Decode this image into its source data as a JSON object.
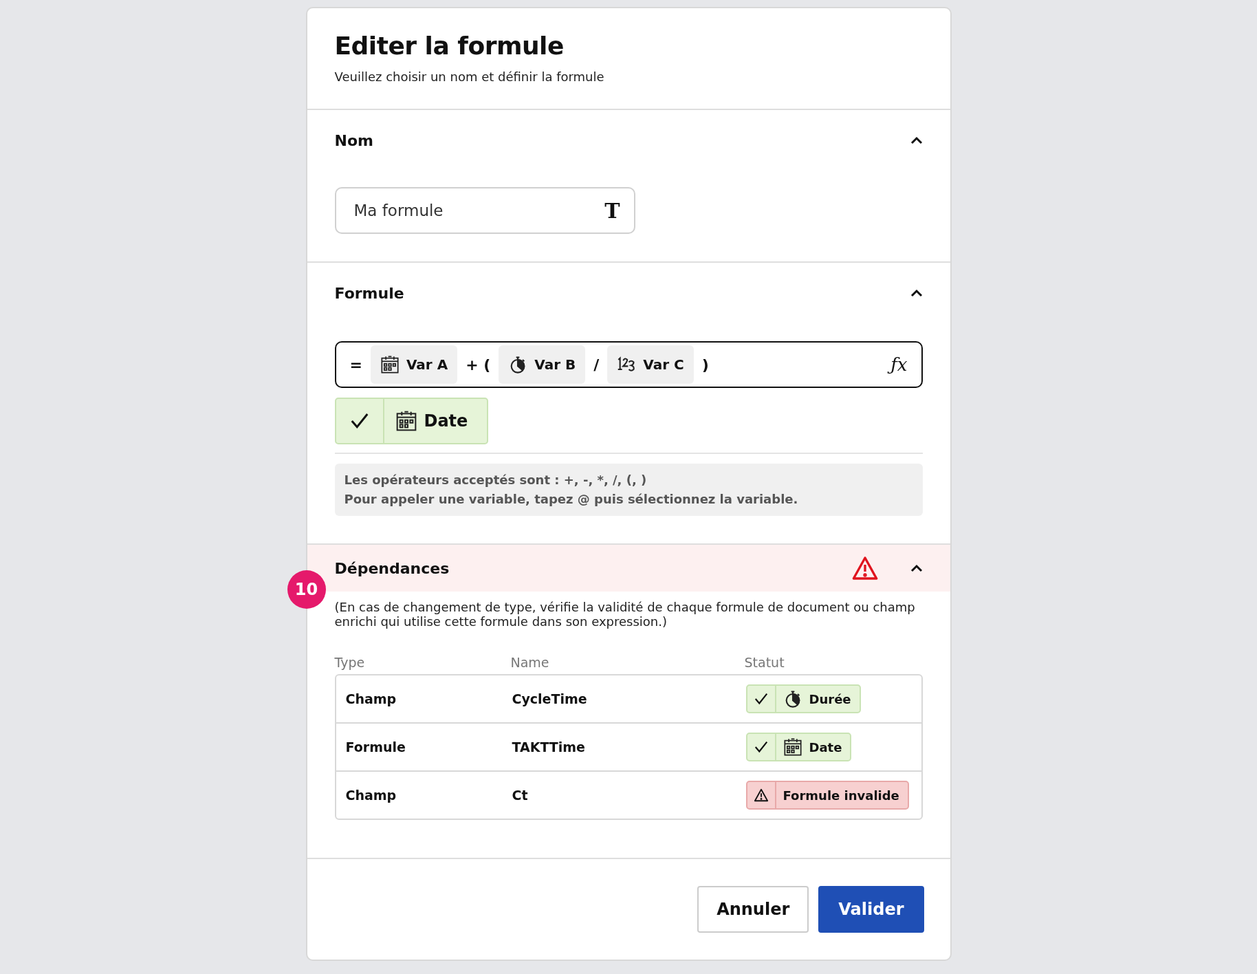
{
  "dialog": {
    "title": "Editer la formule",
    "subtitle": "Veuillez choisir un nom et définir la formule"
  },
  "name_section": {
    "title": "Nom",
    "expanded": true,
    "field": {
      "value": "Ma formule",
      "type_glyph": "T"
    }
  },
  "formula_section": {
    "title": "Formule",
    "expanded": true,
    "tokens": [
      {
        "kind": "operator",
        "text": "="
      },
      {
        "kind": "date",
        "text": "Var A"
      },
      {
        "kind": "operator",
        "text": "+ ("
      },
      {
        "kind": "duration",
        "text": "Var B"
      },
      {
        "kind": "operator",
        "text": "/"
      },
      {
        "kind": "number",
        "text": "Var C"
      },
      {
        "kind": "operator",
        "text": ")"
      }
    ],
    "function_glyph": "ƒx",
    "result": {
      "kind": "date",
      "label": "Date"
    },
    "help": [
      "Les opérateurs acceptés sont : +, -, *, /, (, )",
      "Pour appeler une variable, tapez @ puis sélectionnez la variable."
    ]
  },
  "dependencies_section": {
    "title": "Dépendances",
    "expanded": true,
    "warning": true,
    "badge": "10",
    "note": "(En cas de changement de type, vérifie la validité de chaque formule de document ou champ enrichi qui utilise cette formule dans son expression.)",
    "columns": [
      "Type",
      "Name",
      "Statut"
    ],
    "rows": [
      {
        "type": "Champ",
        "name": "CycleTime",
        "status": {
          "kind": "duration",
          "label": "Durée"
        }
      },
      {
        "type": "Formule",
        "name": "TAKTTime",
        "status": {
          "kind": "date",
          "label": "Date"
        }
      },
      {
        "type": "Champ",
        "name": "Ct",
        "status": {
          "kind": "invalid",
          "label": "Formule invalide"
        }
      }
    ]
  },
  "buttons": [
    {
      "kind": "secondary",
      "label": "Annuler"
    },
    {
      "kind": "primary",
      "label": "Valider"
    }
  ]
}
